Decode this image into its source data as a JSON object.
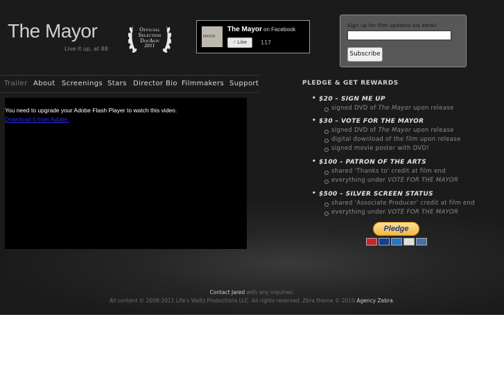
{
  "header": {
    "title": "The Mayor",
    "tagline": "Live it up, at 88"
  },
  "laurel": {
    "line1": "Official",
    "line2": "Selection",
    "line3": "DocAviv",
    "line4": "2011"
  },
  "facebook": {
    "thumb_text": "MAYOR",
    "name": "The Mayor",
    "suffix": "on Facebook",
    "like_label": "Like",
    "like_count": "117"
  },
  "signup": {
    "label": "Sign up for film updates via email",
    "input_value": "",
    "button_label": "Subscribe"
  },
  "nav": {
    "items": [
      {
        "label": "Trailer",
        "active": true
      },
      {
        "label": "About"
      },
      {
        "label": "Screenings"
      },
      {
        "label": "Stars"
      },
      {
        "label": "Director Bio"
      },
      {
        "label": "Filmmakers"
      },
      {
        "label": "Support"
      }
    ]
  },
  "video": {
    "message": "You need to upgrade your Adobe Flash Player to watch this video.",
    "link": "Download it from Adobe."
  },
  "pledge": {
    "title": "PLEDGE & GET REWARDS",
    "tiers": [
      {
        "head": "$20 – SIGN ME UP",
        "perks": [
          {
            "pre": "signed DVD of ",
            "em": "The Mayor",
            "post": " upon release"
          }
        ]
      },
      {
        "head": "$30 – VOTE FOR THE MAYOR",
        "perks": [
          {
            "pre": "signed DVD of ",
            "em": "The Mayor",
            "post": " upon release"
          },
          {
            "pre": "digital download of the film upon release",
            "em": "",
            "post": ""
          },
          {
            "pre": "signed movie poster with DVD!",
            "em": "",
            "post": ""
          }
        ]
      },
      {
        "head": "$100 – PATRON OF THE ARTS",
        "perks": [
          {
            "pre": "shared 'Thanks to' credit at film end",
            "em": "",
            "post": ""
          },
          {
            "pre": "everything under ",
            "em": "VOTE FOR THE MAYOR",
            "post": ""
          }
        ]
      },
      {
        "head": "$500 – SILVER SCREEN STATUS",
        "perks": [
          {
            "pre": "shared 'Associate Producer' credit at film end",
            "em": "",
            "post": ""
          },
          {
            "pre": "everything under ",
            "em": "VOTE FOR THE MAYOR",
            "post": ""
          }
        ]
      }
    ],
    "button_label": "Pledge",
    "cards": [
      {
        "name": "mastercard-icon",
        "color": "#c8262c",
        "text": "MC"
      },
      {
        "name": "visa-icon",
        "color": "#1a3d8f",
        "text": "VISA"
      },
      {
        "name": "amex-icon",
        "color": "#2b74c1",
        "text": "AMEX"
      },
      {
        "name": "discover-icon",
        "color": "#e0e0e0",
        "text": "DISC"
      },
      {
        "name": "bank-icon",
        "color": "#4a6fa5",
        "text": "BANK"
      }
    ]
  },
  "footer": {
    "contact_link": "Contact Jared",
    "contact_rest": " with any inquiries.",
    "copyright": "All content © 2008-2011 Life's Waltz Productions LLC. All rights reserved. Zbra theme © 2010 ",
    "agency_link": "Agency Zebra",
    "period": "."
  }
}
